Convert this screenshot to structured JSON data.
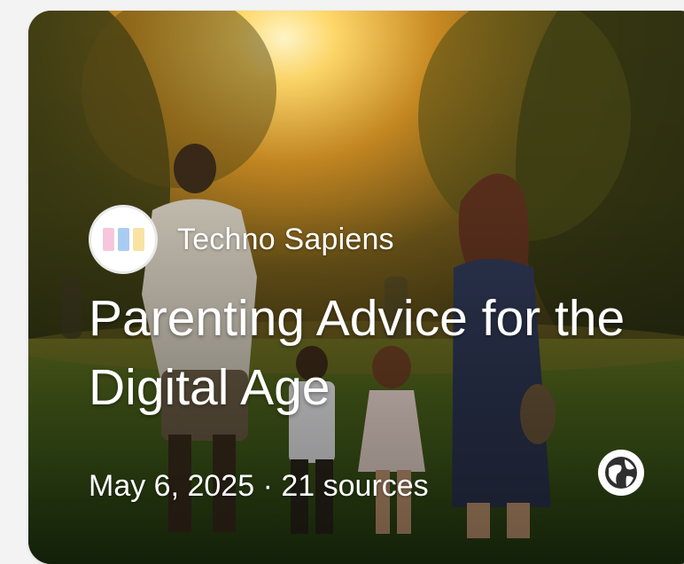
{
  "card": {
    "source": {
      "name": "Techno Sapiens",
      "logo_colors": [
        "#f6c7dc",
        "#a9cdf2",
        "#f8e3a3"
      ]
    },
    "title": "Parenting Advice for the Digital Age",
    "date": "May 6, 2025",
    "separator": "·",
    "sources_count": "21 sources",
    "visibility_icon": "globe-icon",
    "image_description_icon": "family-walking-park-sunset"
  }
}
